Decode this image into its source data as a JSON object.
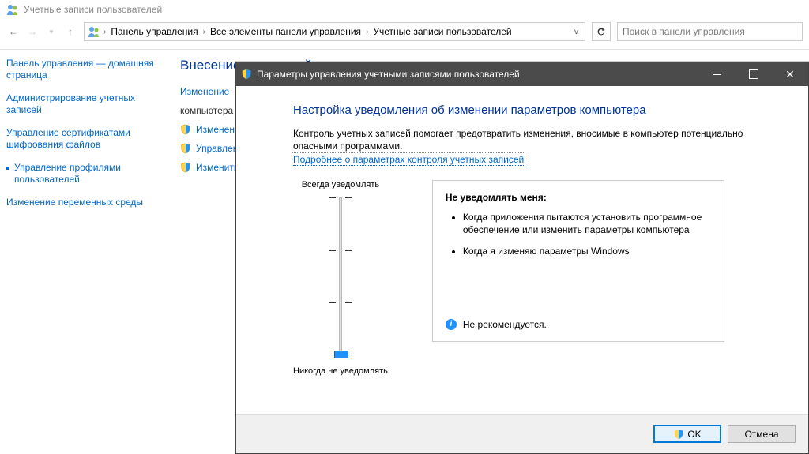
{
  "window": {
    "title": "Учетные записи пользователей"
  },
  "breadcrumbs": {
    "item0": "Панель управления",
    "item1": "Все элементы панели управления",
    "item2": "Учетные записи пользователей"
  },
  "search": {
    "placeholder": "Поиск в панели управления"
  },
  "sidebar": {
    "home": "Панель управления — домашняя страница",
    "link0": "Администрирование учетных записей",
    "link1": "Управление сертификатами шифрования файлов",
    "link2": "Управление профилями пользователей",
    "link3": "Изменение переменных среды"
  },
  "main": {
    "heading": "Внесение изменений в учетную запись пользователя",
    "action0a": "Изменение",
    "action0b": "компьютера",
    "action1": "Изменение",
    "action2": "Управление",
    "action3": "Изменить п"
  },
  "modal": {
    "title": "Параметры управления учетными записями пользователей",
    "heading": "Настройка уведомления об изменении параметров компьютера",
    "desc": "Контроль учетных записей помогает предотвратить изменения, вносимые в компьютер потенциально опасными программами.",
    "link": "Подробнее о параметрах контроля учетных записей",
    "slider_top": "Всегда уведомлять",
    "slider_bottom": "Никогда не уведомлять",
    "box_title": "Не уведомлять меня:",
    "bullet0": "Когда приложения пытаются установить программное обеспечение или изменить параметры компьютера",
    "bullet1": "Когда я изменяю параметры Windows",
    "recommend": "Не рекомендуется.",
    "ok": "OK",
    "cancel": "Отмена"
  }
}
